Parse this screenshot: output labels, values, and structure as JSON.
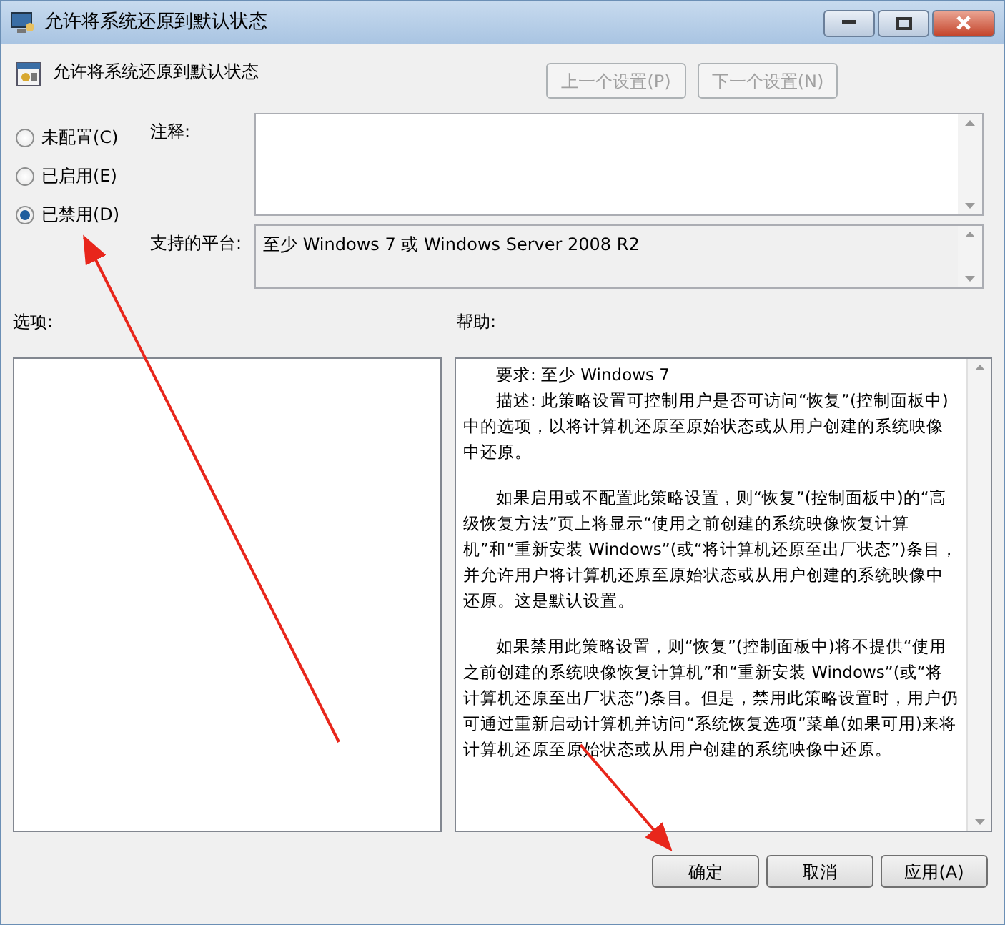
{
  "window": {
    "title": "允许将系统还原到默认状态"
  },
  "setting_title": "允许将系统还原到默认状态",
  "nav_buttons": [
    {
      "label": "上一个设置(P)",
      "disabled": true
    },
    {
      "label": "下一个设置(N)",
      "disabled": true
    }
  ],
  "state_options": [
    {
      "label": "未配置(C)",
      "selected": false
    },
    {
      "label": "已启用(E)",
      "selected": false
    },
    {
      "label": "已禁用(D)",
      "selected": true
    }
  ],
  "comment": {
    "label": "注释:"
  },
  "platform": {
    "label": "支持的平台:",
    "value": "至少 Windows 7 或 Windows Server 2008 R2"
  },
  "options_label": "选项:",
  "help_label": "帮助:",
  "help_paragraphs": [
    "要求: 至少 Windows 7",
    "描述: 此策略设置可控制用户是否可访问“恢复”(控制面板中)中的选项，以将计算机还原至原始状态或从用户创建的系统映像中还原。",
    "如果启用或不配置此策略设置，则“恢复”(控制面板中)的“高级恢复方法”页上将显示“使用之前创建的系统映像恢复计算机”和“重新安装 Windows”(或“将计算机还原至出厂状态”)条目，并允许用户将计算机还原至原始状态或从用户创建的系统映像中还原。这是默认设置。",
    "如果禁用此策略设置，则“恢复”(控制面板中)将不提供“使用之前创建的系统映像恢复计算机”和“重新安装 Windows”(或“将计算机还原至出厂状态”)条目。但是，禁用此策略设置时，用户仍可通过重新启动计算机并访问“系统恢复选项”菜单(如果可用)来将计算机还原至原始状态或从用户创建的系统映像中还原。"
  ],
  "buttons": [
    "确定",
    "取消",
    "应用(A)"
  ]
}
